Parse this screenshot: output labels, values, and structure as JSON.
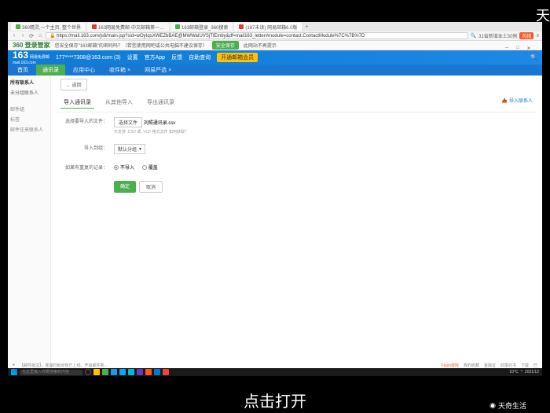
{
  "watermarks": {
    "top": "天",
    "bottom_brand": "天奇生活",
    "caption": "点击打开"
  },
  "browser": {
    "tabs": [
      {
        "label": "360精灵,一个主页, 整个世界"
      },
      {
        "label": "163网易免费邮-中文邮箱第一…"
      },
      {
        "label": "163邮箱登录_360搜索"
      },
      {
        "label": "(187未读) 网易邮箱6.0版"
      }
    ],
    "url": "https://mail.163.com/js6/main.jsp?sid=wOyIqsXWEZbBAE@MWWaIUVSjTlEmby&df=mail163_letter#module=contact.ContactModule%7C%7B%7D",
    "search_hint": "31省新增本土50例",
    "hot": "热搜"
  },
  "security_bar": {
    "brand": "360 登录管家",
    "text": "您安全保存\"163邮箱\"的密码吗？（若您使用网吧或公共电脑不建议保存）",
    "save": "安全保存",
    "hide": "此网站不再提示"
  },
  "mail": {
    "logo": "163",
    "logo_sub": "网易免费邮",
    "domain": "mail.163.com",
    "account": "177****7308@163.com (3)",
    "menu": [
      "设置",
      "官方App",
      "反馈",
      "自助查询"
    ],
    "upgrade": "开通邮箱会员"
  },
  "nav_tabs": [
    "首页",
    "通讯录",
    "应用中心",
    "收件箱",
    "网易严选"
  ],
  "sidebar": {
    "title": "所有联系人",
    "unfiled": "未分组联系人",
    "items": [
      "邮件组",
      "标签",
      "邮件往来联系人"
    ]
  },
  "back": "返回",
  "sub_tabs": [
    "导入通讯录",
    "从其他导入",
    "导出通讯录"
  ],
  "import_link": "导入联系人",
  "form": {
    "file_label": "选择要导入的文件：",
    "file_btn": "选择文件",
    "file_name": "刘照通讯录.csv",
    "file_hint": "只支持 .CSV 或 .VCF 格式文件 如何获取？",
    "group_label": "导入到组：",
    "group_default": "默认分组",
    "dup_label": "如果有重复的记录：",
    "dup_opt1": "不导入",
    "dup_opt2": "覆盖"
  },
  "buttons": {
    "confirm": "确定",
    "cancel": "取消"
  },
  "footer": {
    "left": "【邮件批注】，芜湖扫就出包已上线，开启邮件新…",
    "right_items": [
      "Flash游戏",
      "我的收藏",
      "金融宝",
      "四季的书",
      "下载",
      "已"
    ]
  },
  "taskbar": {
    "search": "在这里输入你要搜索的内容",
    "weather": "10°C",
    "date": "2021/12"
  }
}
